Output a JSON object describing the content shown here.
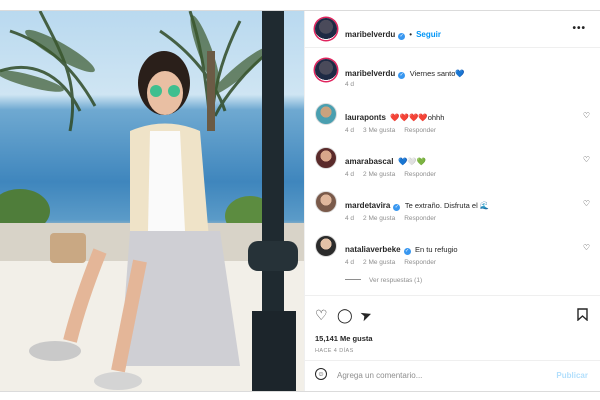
{
  "post": {
    "username": "maribelverdu",
    "follow_label": "Seguir",
    "separator": "•",
    "more_label": "•••",
    "caption_user": "maribelverdu",
    "caption_text": "Viernes santo💙",
    "caption_time": "4 d"
  },
  "comments": [
    {
      "user": "lauraponts",
      "text": "❤️❤️❤️❤️ohhh",
      "time": "4 d",
      "likes": "3 Me gusta",
      "reply": "Responder",
      "verified": false
    },
    {
      "user": "amarabascal",
      "text": "💙🤍💚",
      "time": "4 d",
      "likes": "2 Me gusta",
      "reply": "Responder",
      "verified": false
    },
    {
      "user": "mardetavira",
      "text": "Te extraño. Disfruta el 🌊",
      "time": "4 d",
      "likes": "2 Me gusta",
      "reply": "Responder",
      "verified": true
    },
    {
      "user": "nataliaverbeke",
      "text": "En tu refugio",
      "time": "4 d",
      "likes": "2 Me gusta",
      "reply": "Responder",
      "verified": true
    }
  ],
  "view_replies": "Ver respuestas (1)",
  "likes_count": "15,141 Me gusta",
  "time_ago": "HACE 4 DÍAS",
  "comment_placeholder": "Agrega un comentario...",
  "publish_label": "Publicar",
  "icons": {
    "like": "heart-icon",
    "comment": "comment-icon",
    "share": "send-icon",
    "save": "bookmark-icon",
    "emoji": "smiley-icon",
    "comment_like": "heart-icon"
  },
  "colors": {
    "link": "#0095f6",
    "verified": "#3897f0",
    "publish_disabled": "#b2dffc"
  }
}
